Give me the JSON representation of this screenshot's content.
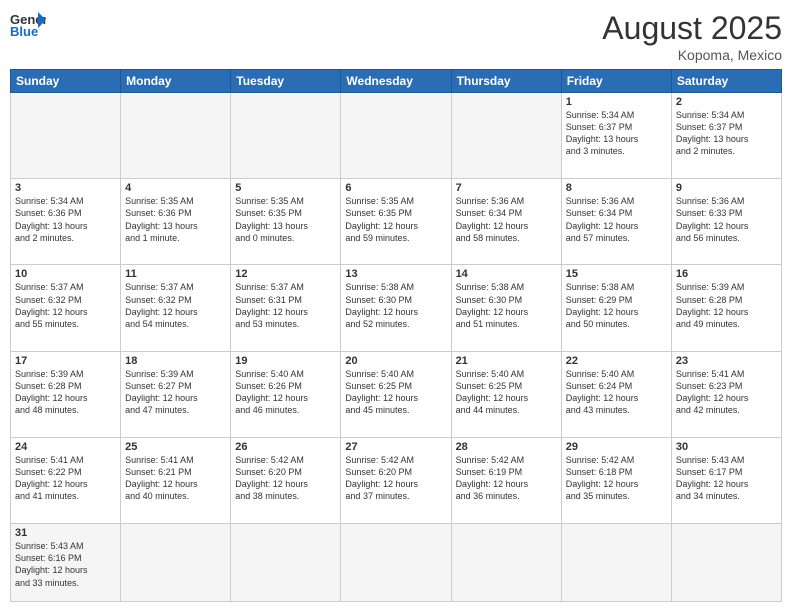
{
  "header": {
    "logo_general": "General",
    "logo_blue": "Blue",
    "month_year": "August 2025",
    "location": "Kopoma, Mexico"
  },
  "weekdays": [
    "Sunday",
    "Monday",
    "Tuesday",
    "Wednesday",
    "Thursday",
    "Friday",
    "Saturday"
  ],
  "weeks": [
    [
      {
        "day": "",
        "info": ""
      },
      {
        "day": "",
        "info": ""
      },
      {
        "day": "",
        "info": ""
      },
      {
        "day": "",
        "info": ""
      },
      {
        "day": "",
        "info": ""
      },
      {
        "day": "1",
        "info": "Sunrise: 5:34 AM\nSunset: 6:37 PM\nDaylight: 13 hours\nand 3 minutes."
      },
      {
        "day": "2",
        "info": "Sunrise: 5:34 AM\nSunset: 6:37 PM\nDaylight: 13 hours\nand 2 minutes."
      }
    ],
    [
      {
        "day": "3",
        "info": "Sunrise: 5:34 AM\nSunset: 6:36 PM\nDaylight: 13 hours\nand 2 minutes."
      },
      {
        "day": "4",
        "info": "Sunrise: 5:35 AM\nSunset: 6:36 PM\nDaylight: 13 hours\nand 1 minute."
      },
      {
        "day": "5",
        "info": "Sunrise: 5:35 AM\nSunset: 6:35 PM\nDaylight: 13 hours\nand 0 minutes."
      },
      {
        "day": "6",
        "info": "Sunrise: 5:35 AM\nSunset: 6:35 PM\nDaylight: 12 hours\nand 59 minutes."
      },
      {
        "day": "7",
        "info": "Sunrise: 5:36 AM\nSunset: 6:34 PM\nDaylight: 12 hours\nand 58 minutes."
      },
      {
        "day": "8",
        "info": "Sunrise: 5:36 AM\nSunset: 6:34 PM\nDaylight: 12 hours\nand 57 minutes."
      },
      {
        "day": "9",
        "info": "Sunrise: 5:36 AM\nSunset: 6:33 PM\nDaylight: 12 hours\nand 56 minutes."
      }
    ],
    [
      {
        "day": "10",
        "info": "Sunrise: 5:37 AM\nSunset: 6:32 PM\nDaylight: 12 hours\nand 55 minutes."
      },
      {
        "day": "11",
        "info": "Sunrise: 5:37 AM\nSunset: 6:32 PM\nDaylight: 12 hours\nand 54 minutes."
      },
      {
        "day": "12",
        "info": "Sunrise: 5:37 AM\nSunset: 6:31 PM\nDaylight: 12 hours\nand 53 minutes."
      },
      {
        "day": "13",
        "info": "Sunrise: 5:38 AM\nSunset: 6:30 PM\nDaylight: 12 hours\nand 52 minutes."
      },
      {
        "day": "14",
        "info": "Sunrise: 5:38 AM\nSunset: 6:30 PM\nDaylight: 12 hours\nand 51 minutes."
      },
      {
        "day": "15",
        "info": "Sunrise: 5:38 AM\nSunset: 6:29 PM\nDaylight: 12 hours\nand 50 minutes."
      },
      {
        "day": "16",
        "info": "Sunrise: 5:39 AM\nSunset: 6:28 PM\nDaylight: 12 hours\nand 49 minutes."
      }
    ],
    [
      {
        "day": "17",
        "info": "Sunrise: 5:39 AM\nSunset: 6:28 PM\nDaylight: 12 hours\nand 48 minutes."
      },
      {
        "day": "18",
        "info": "Sunrise: 5:39 AM\nSunset: 6:27 PM\nDaylight: 12 hours\nand 47 minutes."
      },
      {
        "day": "19",
        "info": "Sunrise: 5:40 AM\nSunset: 6:26 PM\nDaylight: 12 hours\nand 46 minutes."
      },
      {
        "day": "20",
        "info": "Sunrise: 5:40 AM\nSunset: 6:25 PM\nDaylight: 12 hours\nand 45 minutes."
      },
      {
        "day": "21",
        "info": "Sunrise: 5:40 AM\nSunset: 6:25 PM\nDaylight: 12 hours\nand 44 minutes."
      },
      {
        "day": "22",
        "info": "Sunrise: 5:40 AM\nSunset: 6:24 PM\nDaylight: 12 hours\nand 43 minutes."
      },
      {
        "day": "23",
        "info": "Sunrise: 5:41 AM\nSunset: 6:23 PM\nDaylight: 12 hours\nand 42 minutes."
      }
    ],
    [
      {
        "day": "24",
        "info": "Sunrise: 5:41 AM\nSunset: 6:22 PM\nDaylight: 12 hours\nand 41 minutes."
      },
      {
        "day": "25",
        "info": "Sunrise: 5:41 AM\nSunset: 6:21 PM\nDaylight: 12 hours\nand 40 minutes."
      },
      {
        "day": "26",
        "info": "Sunrise: 5:42 AM\nSunset: 6:20 PM\nDaylight: 12 hours\nand 38 minutes."
      },
      {
        "day": "27",
        "info": "Sunrise: 5:42 AM\nSunset: 6:20 PM\nDaylight: 12 hours\nand 37 minutes."
      },
      {
        "day": "28",
        "info": "Sunrise: 5:42 AM\nSunset: 6:19 PM\nDaylight: 12 hours\nand 36 minutes."
      },
      {
        "day": "29",
        "info": "Sunrise: 5:42 AM\nSunset: 6:18 PM\nDaylight: 12 hours\nand 35 minutes."
      },
      {
        "day": "30",
        "info": "Sunrise: 5:43 AM\nSunset: 6:17 PM\nDaylight: 12 hours\nand 34 minutes."
      }
    ],
    [
      {
        "day": "31",
        "info": "Sunrise: 5:43 AM\nSunset: 6:16 PM\nDaylight: 12 hours\nand 33 minutes."
      },
      {
        "day": "",
        "info": ""
      },
      {
        "day": "",
        "info": ""
      },
      {
        "day": "",
        "info": ""
      },
      {
        "day": "",
        "info": ""
      },
      {
        "day": "",
        "info": ""
      },
      {
        "day": "",
        "info": ""
      }
    ]
  ]
}
